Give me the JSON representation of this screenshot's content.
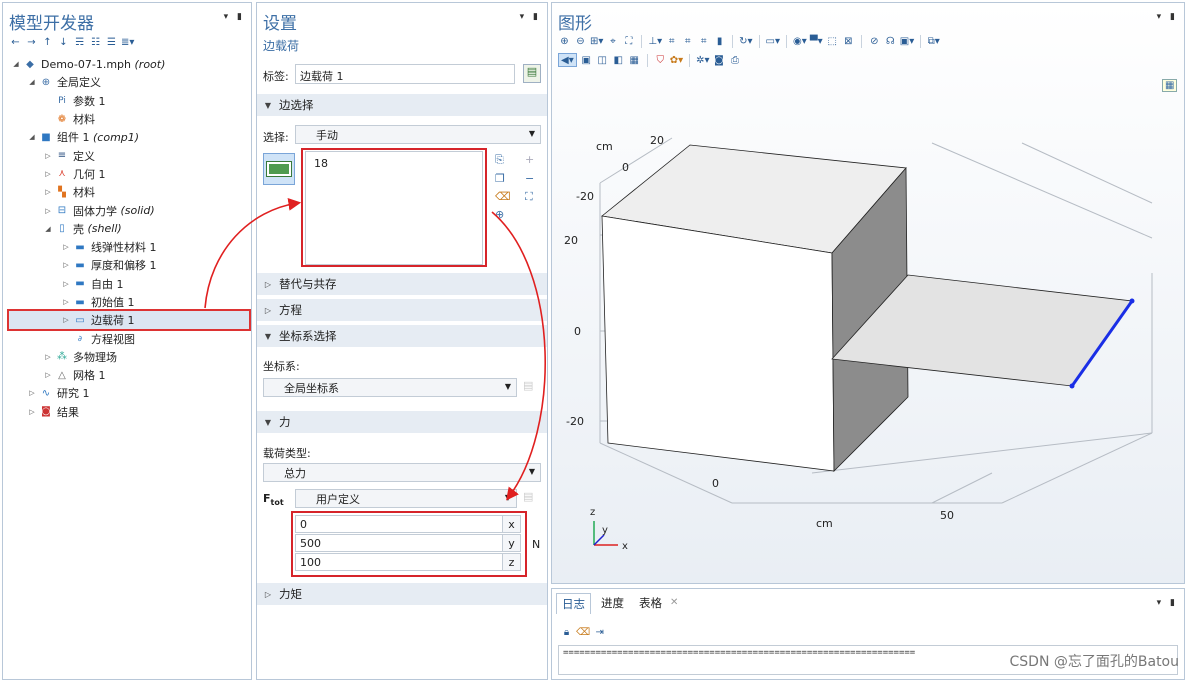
{
  "model_builder": {
    "title": "模型开发器",
    "tree": [
      {
        "label": "Demo-07-1.mph",
        "tag": "(root)",
        "icon": "file-icon"
      },
      {
        "label": "全局定义",
        "tag": "",
        "icon": "globe-icon"
      },
      {
        "label": "参数 1",
        "tag": "",
        "icon": "parameter-icon"
      },
      {
        "label": "材料",
        "tag": "",
        "icon": "material-icon"
      },
      {
        "label": "组件 1",
        "tag": "(comp1)",
        "icon": "component-icon"
      },
      {
        "label": "定义",
        "tag": "",
        "icon": "definitions-icon"
      },
      {
        "label": "几何 1",
        "tag": "",
        "icon": "geometry-icon"
      },
      {
        "label": "材料",
        "tag": "",
        "icon": "materials-icon"
      },
      {
        "label": "固体力学",
        "tag": "(solid)",
        "icon": "solid-mechanics-icon"
      },
      {
        "label": "壳",
        "tag": "(shell)",
        "icon": "shell-icon"
      },
      {
        "label": "线弹性材料 1",
        "tag": "",
        "icon": "linear-elastic-icon"
      },
      {
        "label": "厚度和偏移 1",
        "tag": "",
        "icon": "thickness-icon"
      },
      {
        "label": "自由 1",
        "tag": "",
        "icon": "free-icon"
      },
      {
        "label": "初始值 1",
        "tag": "",
        "icon": "initial-values-icon"
      },
      {
        "label": "边载荷 1",
        "tag": "",
        "icon": "edge-load-icon"
      },
      {
        "label": "方程视图",
        "tag": "",
        "icon": "equation-view-icon"
      },
      {
        "label": "多物理场",
        "tag": "",
        "icon": "multiphysics-icon"
      },
      {
        "label": "网格 1",
        "tag": "",
        "icon": "mesh-icon"
      },
      {
        "label": "研究 1",
        "tag": "",
        "icon": "study-icon"
      },
      {
        "label": "结果",
        "tag": "",
        "icon": "results-icon"
      }
    ]
  },
  "settings": {
    "title": "设置",
    "subtitle": "边载荷",
    "label_caption": "标签:",
    "label_value": "边载荷 1",
    "sec_edge": "边选择",
    "selection_caption": "选择:",
    "selection_value": "手动",
    "selection_items": [
      "18"
    ],
    "sec_override": "替代与共存",
    "sec_equation": "方程",
    "sec_coord": "坐标系选择",
    "coord_caption": "坐标系:",
    "coord_value": "全局坐标系",
    "sec_force": "力",
    "load_type_caption": "载荷类型:",
    "load_type_value": "总力",
    "ftot_label": "F",
    "ftot_sub": "tot",
    "ftot_value": "用户定义",
    "force": [
      {
        "value": "0",
        "unit": "x"
      },
      {
        "value": "500",
        "unit": "y"
      },
      {
        "value": "100",
        "unit": "z"
      }
    ],
    "force_unit": "N",
    "sec_moment": "力矩"
  },
  "graphics": {
    "title": "图形",
    "axis_unit_top": "cm",
    "axis_unit_bottom": "cm",
    "ticks_left": [
      "-20",
      "20",
      "0",
      "-20"
    ],
    "ticks_top": [
      "20",
      "0"
    ],
    "ticks_bottom": [
      "0",
      "50"
    ],
    "triad": {
      "z": "z",
      "y": "y",
      "x": "x"
    },
    "edge_color": "#1a2ee6"
  },
  "log": {
    "tabs": [
      "日志",
      "进度",
      "表格"
    ],
    "output": "================================================================="
  },
  "watermark": "CSDN @忘了面孔的Batou"
}
